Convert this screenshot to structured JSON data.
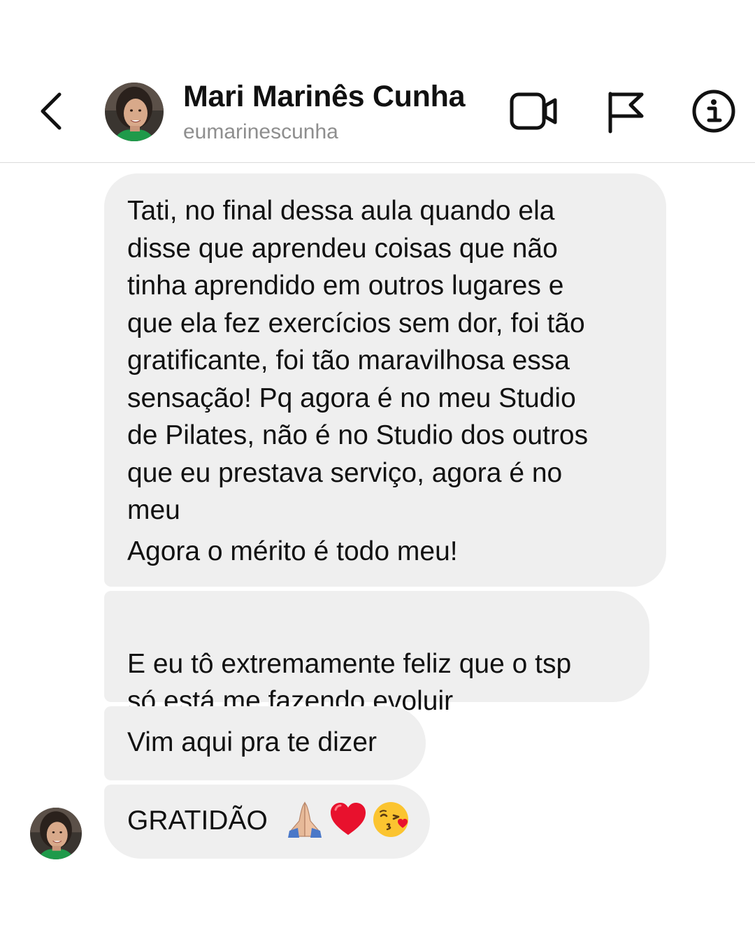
{
  "header": {
    "back_icon": "chevron-left-icon",
    "contact_name": "Mari Marinês Cunha",
    "contact_username": "eumarinescunha",
    "actions": [
      {
        "name": "video-call",
        "icon": "video-camera-icon"
      },
      {
        "name": "report",
        "icon": "flag-icon"
      },
      {
        "name": "info",
        "icon": "info-circle-icon"
      }
    ]
  },
  "messages": [
    {
      "paragraphs": [
        "Tati, no final dessa aula quando ela\ndisse que aprendeu coisas que não\ntinha aprendido em outros lugares e\nque ela fez exercícios sem dor, foi tão\ngratificante, foi tão maravilhosa essa\nsensação! Pq agora é no meu Studio\nde Pilates, não é no Studio dos outros\nque eu prestava serviço, agora é no\nmeu",
        "Agora o mérito é todo meu!"
      ]
    },
    {
      "text": "E eu tô extremamente feliz que o tsp\nsó está me fazendo evoluir"
    },
    {
      "text": "Vim aqui pra te dizer"
    },
    {
      "text": "GRATIDÃO",
      "emojis": [
        "praying-hands-icon",
        "red-heart-icon",
        "face-blowing-kiss-icon"
      ]
    }
  ],
  "colors": {
    "bubble_background": "#efefef",
    "username_gray": "#8e8e8e",
    "divider": "#dbdbdb",
    "heart_red": "#e8112d"
  }
}
